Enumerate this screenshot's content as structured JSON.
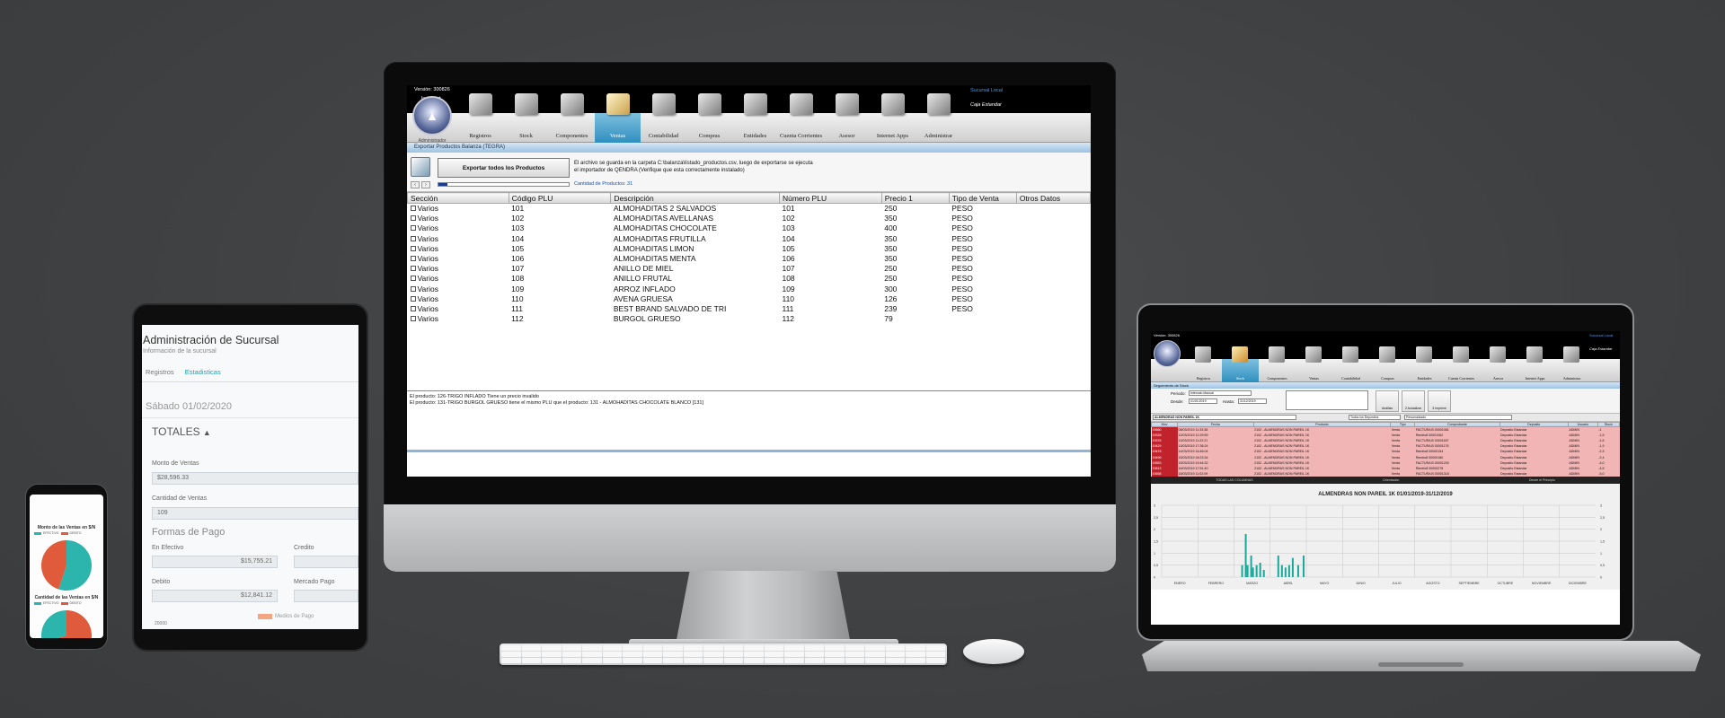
{
  "imac_app": {
    "version": "Versión: 300826",
    "host": "localhost",
    "branch": "Sucursal Local",
    "cashbox": "Caja Estandar",
    "logo_caption": "Administrador",
    "nav": [
      {
        "label": "Registros",
        "active": false
      },
      {
        "label": "Stock",
        "active": false
      },
      {
        "label": "Componentes",
        "active": false
      },
      {
        "label": "Ventas",
        "active": true
      },
      {
        "label": "Contabilidad",
        "active": false
      },
      {
        "label": "Compras",
        "active": false
      },
      {
        "label": "Entidades",
        "active": false
      },
      {
        "label": "Cuenta Corrientes",
        "active": false
      },
      {
        "label": "Asesor",
        "active": false
      },
      {
        "label": "Internet Apps",
        "active": false
      },
      {
        "label": "Administrar",
        "active": false
      }
    ],
    "section_title": "Exportar Productos Balanza (TEGRA)",
    "export_button": "Exportar todos los Productos",
    "export_message_1": "El archivo se guarda en la carpeta C:\\balanza\\listado_productos.csv, luego de exportarse se ejecuta",
    "export_message_2": "el importador de QENDRA (Verifique que esta correctamente instalado)",
    "product_count": "Cantidad de Productos: 31",
    "progress": 0.07,
    "columns": [
      "Sección",
      "Código PLU",
      "Descripción",
      "Número PLU",
      "Precio 1",
      "Tipo de Venta",
      "Otros Datos"
    ],
    "rows": [
      [
        "Varios",
        "101",
        "ALMOHADITAS 2 SALVADOS",
        "101",
        "250",
        "PESO",
        ""
      ],
      [
        "Varios",
        "102",
        "ALMOHADITAS AVELLANAS",
        "102",
        "350",
        "PESO",
        ""
      ],
      [
        "Varios",
        "103",
        "ALMOHADITAS CHOCOLATE",
        "103",
        "400",
        "PESO",
        ""
      ],
      [
        "Varios",
        "104",
        "ALMOHADITAS FRUTILLA",
        "104",
        "350",
        "PESO",
        ""
      ],
      [
        "Varios",
        "105",
        "ALMOHADITAS LIMON",
        "105",
        "350",
        "PESO",
        ""
      ],
      [
        "Varios",
        "106",
        "ALMOHADITAS MENTA",
        "106",
        "350",
        "PESO",
        ""
      ],
      [
        "Varios",
        "107",
        "ANILLO DE MIEL",
        "107",
        "250",
        "PESO",
        ""
      ],
      [
        "Varios",
        "108",
        "ANILLO FRUTAL",
        "108",
        "250",
        "PESO",
        ""
      ],
      [
        "Varios",
        "109",
        "ARROZ INFLADO",
        "109",
        "300",
        "PESO",
        ""
      ],
      [
        "Varios",
        "110",
        "AVENA GRUESA",
        "110",
        "126",
        "PESO",
        ""
      ],
      [
        "Varios",
        "111",
        "BEST BRAND SALVADO DE TRI",
        "111",
        "239",
        "PESO",
        ""
      ],
      [
        "Varios",
        "112",
        "BURGOL GRUESO",
        "112",
        "79",
        "",
        ""
      ]
    ],
    "log_1": "El producto: 126-TRIGO INFLADO Tiene un precio invalido",
    "log_2": "El producto: 131-TRIGO BURGOL GRUESO tiene el mismo PLU que el producto: 131 - ALMOHADITAS CHOCOLATE BLANCO [131]"
  },
  "tablet": {
    "title": "Administración de Sucursal",
    "subtitle": "Información de la sucursal",
    "tab_registros": "Registros",
    "tab_estadisticas": "Estadisticas",
    "date": "Sábado 01/02/2020",
    "totales": "TOTALES",
    "monto_label": "Monto de Ventas",
    "monto_value": "$28,596.33",
    "cantidad_label": "Cantidad de Ventas",
    "cantidad_value": "109",
    "formas_title": "Formas de Pago",
    "efectivo_label": "En Efectivo",
    "efectivo_value": "$15,755.21",
    "credito_label": "Credito",
    "debito_label": "Debito",
    "debito_value": "$12,841.12",
    "mercado_label": "Mercado Pago",
    "legend_label": "Medios de Pago",
    "axis_value": "20000"
  },
  "phone": {
    "title_1": "Monto de las Ventas en $/N",
    "title_2": "Cantidad de las Ventas en $/N",
    "pie_1": [
      {
        "label": "EFECTIVO",
        "value": 55,
        "color": "#2bb5ac"
      },
      {
        "label": "DEBITO",
        "value": 45,
        "color": "#e05b3c"
      }
    ],
    "pie_2": [
      {
        "label": "EFECTIVO",
        "value": 70,
        "color": "#e05b3c"
      },
      {
        "label": "DEBITO",
        "value": 30,
        "color": "#2bb5ac"
      }
    ]
  },
  "laptop_app": {
    "version": "Versión: 300826",
    "branch": "Sucursal Local",
    "cashbox": "Caja Estandar",
    "nav": [
      {
        "label": "Registros",
        "active": false
      },
      {
        "label": "Stock",
        "active": true
      },
      {
        "label": "Componentes",
        "active": false
      },
      {
        "label": "Ventas",
        "active": false
      },
      {
        "label": "Contabilidad",
        "active": false
      },
      {
        "label": "Compras",
        "active": false
      },
      {
        "label": "Entidades",
        "active": false
      },
      {
        "label": "Cuenta Corrientes",
        "active": false
      },
      {
        "label": "Asesor",
        "active": false
      },
      {
        "label": "Internet Apps",
        "active": false
      },
      {
        "label": "Administrar",
        "active": false
      }
    ],
    "section_title": "Seguimiento de Stock",
    "periodo_label": "Periodo:",
    "periodo_value": "Intervalo Manual",
    "desde_label": "Desde:",
    "desde_value": "01/01/2019",
    "hasta_label": "Hasta:",
    "hasta_value": "31/12/2019",
    "analisis_btn": "Análisis",
    "actualizar_btn": "2 Actualizar",
    "imprimir_btn": "3 Imprimir",
    "product_select": "ALMENDRAS NON PAREIL 1K",
    "deposito_select": "Todos los Depositos",
    "personalizado_select": "Personalizado",
    "grid_columns": [
      "Mov",
      "Fecha",
      "Producto",
      "Tipo",
      "Comprobante",
      "Deposito",
      "Usuario",
      "Stock"
    ],
    "grid_rows": [
      [
        "19660",
        "08/03/2019 11:33:38",
        "2102 - ALMENDRAS NON PAREIL 1K",
        "Venta",
        "FACTURA B 00001061",
        "Deposito Estandar",
        "ADMIN",
        "-1"
      ],
      [
        "19328",
        "12/03/2019 12:29:59",
        "2102 - ALMENDRAS NON PAREIL 1K",
        "Venta",
        "Remito8 00001062",
        "Deposito Estandar",
        "ADMIN",
        "-1,5"
      ],
      [
        "19376",
        "13/03/2019 11:22:21",
        "2102 - ALMENDRAS NON PAREIL 1K",
        "Venta",
        "FACTURA B 00001187",
        "Deposito Estandar",
        "ADMIN",
        "-1,6"
      ],
      [
        "19429",
        "13/03/2019 17:36:24",
        "2102 - ALMENDRAS NON PAREIL 1K",
        "Venta",
        "FACTURA B 00001176",
        "Deposito Estandar",
        "ADMIN",
        "-1,9"
      ],
      [
        "19476",
        "14/03/2019 16:46:04",
        "2102 - ALMENDRAS NON PAREIL 1K",
        "Venta",
        "Remito8 00000154",
        "Deposito Estandar",
        "ADMIN",
        "-2,3"
      ],
      [
        "19496",
        "15/03/2019 18:23:34",
        "2102 - ALMENDRAS NON PAREIL 1K",
        "Venta",
        "Remito8 00000180",
        "Deposito Estandar",
        "ADMIN",
        "-2,4"
      ],
      [
        "19553",
        "15/03/2019 19:44:32",
        "2102 - ALMENDRAS NON PAREIL 1K",
        "Venta",
        "FACTURA B 00001200",
        "Deposito Estandar",
        "ADMIN",
        "-4,0"
      ],
      [
        "19613",
        "16/03/2019 17:51:40",
        "2102 - ALMENDRAS NON PAREIL 1K",
        "Venta",
        "Remito8 00000278",
        "Deposito Estandar",
        "ADMIN",
        "-4,5"
      ],
      [
        "19698",
        "18/03/2019 11:02:09",
        "2102 - ALMENDRAS NON PAREIL 1K",
        "Venta",
        "FACTURA B 00001318",
        "Deposito Estandar",
        "ADMIN",
        "-5,0"
      ]
    ],
    "bar_1": "TODAS LAS COLUMNAS",
    "bar_2": "Orientación",
    "bar_3": "Desde el Principio",
    "chart_title": "ALMENDRAS NON PAREIL 1K  01/01/2019-31/12/2019"
  },
  "chart_data": {
    "type": "bar",
    "title": "ALMENDRAS NON PAREIL 1K  01/01/2019-31/12/2019",
    "categories": [
      "ENERO",
      "FEBRERO",
      "MARZO",
      "ABRIL",
      "MAYO",
      "JUNIO",
      "JULIO",
      "AGOSTO",
      "SEPTIEMBRE",
      "OCTUBRE",
      "NOVIEMBRE",
      "DICIEMBRE"
    ],
    "ylim": [
      0,
      3
    ],
    "yticks": [
      "3",
      "2,5",
      "2",
      "1,5",
      "1",
      "0,5",
      "0"
    ],
    "bars": [
      {
        "x": 2.2,
        "value": 0.5
      },
      {
        "x": 2.3,
        "value": 1.8
      },
      {
        "x": 2.35,
        "value": 0.5
      },
      {
        "x": 2.45,
        "value": 0.9
      },
      {
        "x": 2.5,
        "value": 0.4
      },
      {
        "x": 2.6,
        "value": 0.5
      },
      {
        "x": 2.7,
        "value": 0.6
      },
      {
        "x": 2.8,
        "value": 0.3
      },
      {
        "x": 3.2,
        "value": 0.9
      },
      {
        "x": 3.3,
        "value": 0.5
      },
      {
        "x": 3.4,
        "value": 0.4
      },
      {
        "x": 3.5,
        "value": 0.5
      },
      {
        "x": 3.6,
        "value": 0.8
      },
      {
        "x": 3.75,
        "value": 0.5
      },
      {
        "x": 3.9,
        "value": 0.9
      }
    ],
    "grid": true,
    "bar_color": "#1aa89a"
  }
}
